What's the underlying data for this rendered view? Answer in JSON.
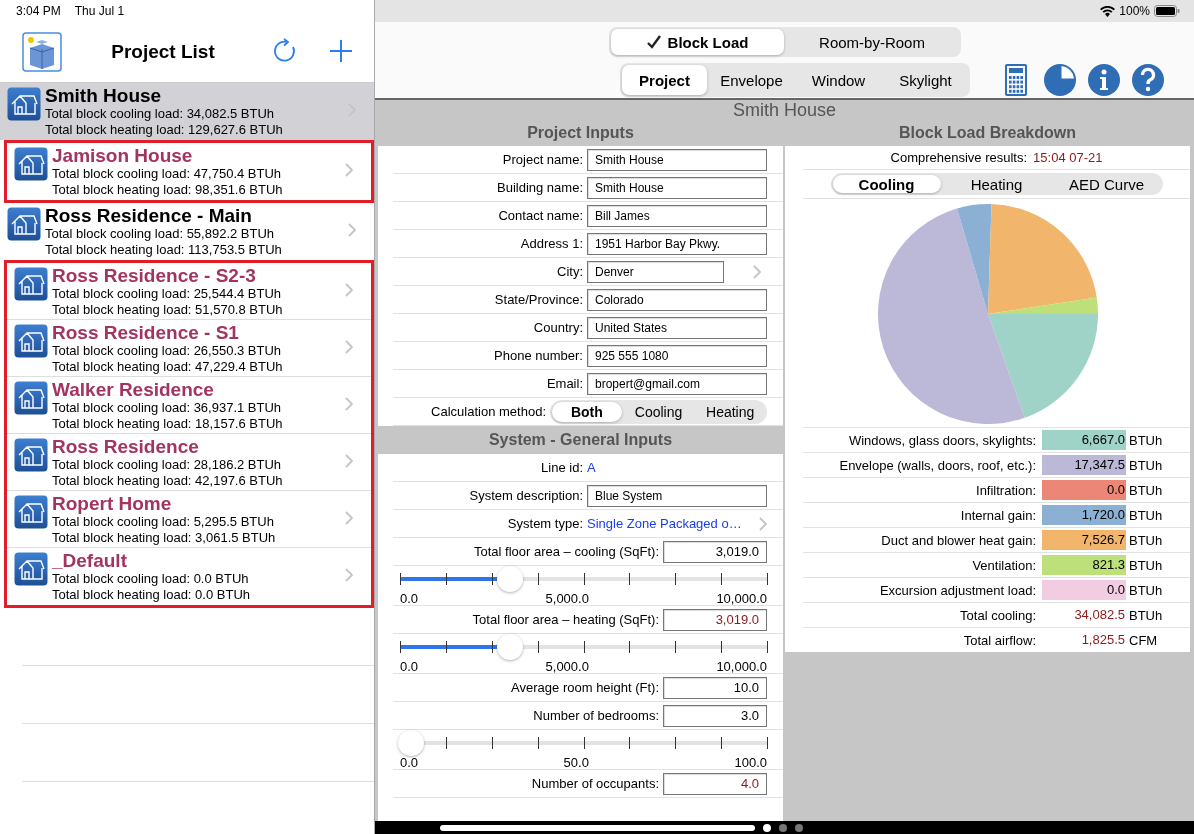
{
  "status_bar": {
    "time": "3:04 PM",
    "date": "Thu Jul 1",
    "battery": "100%"
  },
  "sidebar": {
    "title": "Project List",
    "projects": [
      {
        "name": "Smith House",
        "cooling": "Total block cooling load: 34,082.5 BTUh",
        "heating": "Total block heating load: 129,627.6 BTUh",
        "selected": true,
        "highlighted": false
      },
      {
        "name": "Jamison House",
        "cooling": "Total block cooling load: 47,750.4 BTUh",
        "heating": "Total block heating load: 98,351.6 BTUh",
        "selected": false,
        "highlighted": true
      },
      {
        "name": "Ross Residence - Main",
        "cooling": "Total block cooling load: 55,892.2 BTUh",
        "heating": "Total block heating load: 113,753.5 BTUh",
        "selected": false,
        "highlighted": false
      },
      {
        "name": "Ross Residence - S2-3",
        "cooling": "Total block cooling load: 25,544.4 BTUh",
        "heating": "Total block heating load: 51,570.8 BTUh",
        "selected": false,
        "highlighted": true
      },
      {
        "name": "Ross Residence - S1",
        "cooling": "Total block cooling load: 26,550.3 BTUh",
        "heating": "Total block heating load: 47,229.4 BTUh",
        "selected": false,
        "highlighted": true
      },
      {
        "name": "Walker Residence",
        "cooling": "Total block cooling load: 36,937.1 BTUh",
        "heating": "Total block heating load: 18,157.6 BTUh",
        "selected": false,
        "highlighted": true
      },
      {
        "name": "Ross Residence",
        "cooling": "Total block cooling load: 28,186.2 BTUh",
        "heating": "Total block heating load: 42,197.6 BTUh",
        "selected": false,
        "highlighted": true
      },
      {
        "name": "Ropert Home",
        "cooling": "Total block cooling load: 5,295.5 BTUh",
        "heating": "Total block heating load: 3,061.5 BTUh",
        "selected": false,
        "highlighted": true
      },
      {
        "name": "_Default",
        "cooling": "Total block cooling load: 0.0 BTUh",
        "heating": "Total block heating load: 0.0 BTUh",
        "selected": false,
        "highlighted": true
      }
    ]
  },
  "mode_tabs": [
    {
      "label": "Block Load",
      "selected": true
    },
    {
      "label": "Room-by-Room",
      "selected": false
    }
  ],
  "section_tabs": [
    {
      "label": "Project",
      "selected": true
    },
    {
      "label": "Envelope",
      "selected": false
    },
    {
      "label": "Window",
      "selected": false
    },
    {
      "label": "Skylight",
      "selected": false
    }
  ],
  "project_title": "Smith House",
  "project_inputs": {
    "title": "Project Inputs",
    "rows": [
      {
        "kind": "field",
        "label": "Project name:",
        "value": "Smith House"
      },
      {
        "kind": "field",
        "label": "Building name:",
        "value": "Smith House"
      },
      {
        "kind": "field",
        "label": "Contact name:",
        "value": "Bill James"
      },
      {
        "kind": "field",
        "label": "Address 1:",
        "value": "1951 Harbor Bay Pkwy."
      },
      {
        "kind": "picker",
        "label": "City:",
        "value": "Denver"
      },
      {
        "kind": "field",
        "label": "State/Province:",
        "value": "Colorado"
      },
      {
        "kind": "field",
        "label": "Country:",
        "value": "United States"
      },
      {
        "kind": "field",
        "label": "Phone number:",
        "value": "925 555 1080"
      },
      {
        "kind": "field",
        "label": "Email:",
        "value": "bropert@gmail.com"
      },
      {
        "kind": "segmented",
        "label": "Calculation method:",
        "options": [
          {
            "label": "Both",
            "selected": true
          },
          {
            "label": "Cooling",
            "selected": false
          },
          {
            "label": "Heating",
            "selected": false
          }
        ]
      }
    ]
  },
  "system_inputs": {
    "title": "System - General Inputs",
    "rows": [
      {
        "kind": "link",
        "label": "Line id:",
        "value": "A"
      },
      {
        "kind": "field",
        "label": "System description:",
        "value": "Blue System"
      },
      {
        "kind": "menu",
        "label": "System type:",
        "value": "Single Zone Packaged o…"
      },
      {
        "kind": "number",
        "label": "Total floor area – cooling (SqFt):",
        "value": "3,019.0",
        "modified": false
      },
      {
        "kind": "slider",
        "level": 0.3,
        "ticks": [
          "0.0",
          "5,000.0",
          "10,000.0"
        ]
      },
      {
        "kind": "number",
        "label": "Total floor area – heating (SqFt):",
        "value": "3,019.0",
        "modified": true
      },
      {
        "kind": "slider",
        "level": 0.3,
        "ticks": [
          "0.0",
          "5,000.0",
          "10,000.0"
        ]
      },
      {
        "kind": "number",
        "label": "Average room height (Ft):",
        "value": "10.0",
        "modified": false
      },
      {
        "kind": "number",
        "label": "Number of bedrooms:",
        "value": "3.0",
        "modified": false
      },
      {
        "kind": "slider",
        "level": 0.03,
        "ticks": [
          "0.0",
          "50.0",
          "100.0"
        ]
      },
      {
        "kind": "number",
        "label": "Number of occupants:",
        "value": "4.0",
        "modified": true
      }
    ]
  },
  "breakdown": {
    "title": "Block Load Breakdown",
    "results_label": "Comprehensive results:",
    "results_time": "15:04 07-21",
    "tabs": [
      {
        "label": "Cooling",
        "selected": true
      },
      {
        "label": "Heating",
        "selected": false
      },
      {
        "label": "AED Curve",
        "selected": false
      }
    ],
    "rows": [
      {
        "label": "Windows, glass doors, skylights:",
        "value": "6,667.0",
        "unit": "BTUh",
        "color": "#9fd3c7"
      },
      {
        "label": "Envelope (walls, doors, roof, etc.):",
        "value": "17,347.5",
        "unit": "BTUh",
        "color": "#bcb8d8"
      },
      {
        "label": "Infiltration:",
        "value": "0.0",
        "unit": "BTUh",
        "color": "#ec8677"
      },
      {
        "label": "Internal gain:",
        "value": "1,720.0",
        "unit": "BTUh",
        "color": "#8bb0d4"
      },
      {
        "label": "Duct and blower heat gain:",
        "value": "7,526.7",
        "unit": "BTUh",
        "color": "#f1b56b"
      },
      {
        "label": "Ventilation:",
        "value": "821.3",
        "unit": "BTUh",
        "color": "#bde07a"
      },
      {
        "label": "Excursion adjustment load:",
        "value": "0.0",
        "unit": "BTUh",
        "color": "#f2cde2"
      }
    ],
    "totals": [
      {
        "label": "Total cooling:",
        "value": "34,082.5",
        "unit": "BTUh"
      },
      {
        "label": "Total airflow:",
        "value": "1,825.5",
        "unit": "CFM"
      }
    ]
  },
  "page_dots": [
    {
      "selected": true
    },
    {
      "selected": false
    },
    {
      "selected": false
    }
  ]
}
